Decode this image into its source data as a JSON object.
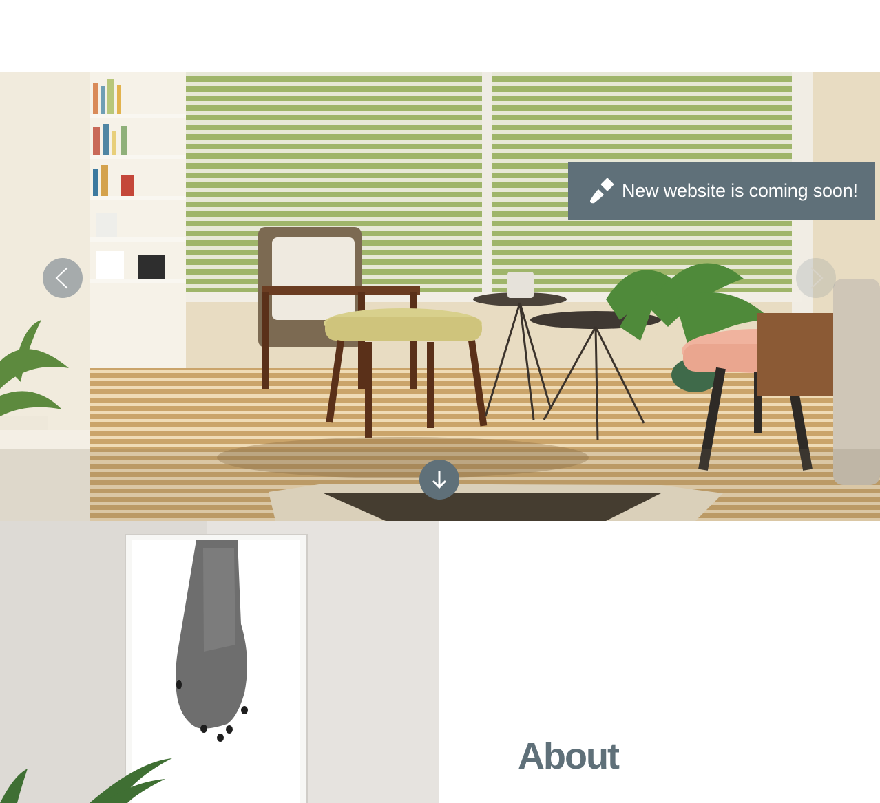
{
  "banner": {
    "notice_text": "New website is coming soon!",
    "notice_icon": "paintbrush-icon",
    "notice_color": "#5f7079"
  },
  "slider": {
    "prev_icon": "chevron-left-icon",
    "next_icon": "chevron-right-icon",
    "scroll_icon": "arrow-down-icon"
  },
  "about": {
    "title": "About"
  },
  "colors": {
    "accent": "#5f7079",
    "background": "#ffffff"
  }
}
